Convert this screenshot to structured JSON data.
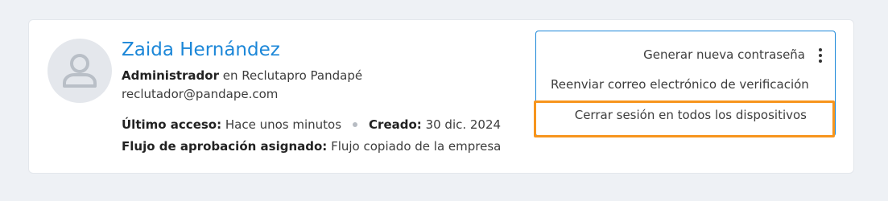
{
  "user": {
    "name": "Zaida Hernández",
    "role": "Administrador",
    "company_prefix": " en ",
    "company": "Reclutapro Pandapé",
    "email": "reclutador@pandape.com",
    "last_access_label": "Último acceso:",
    "last_access_value": " Hace unos minutos",
    "created_label": "Creado:",
    "created_value": " 30 dic. 2024",
    "flow_label": "Flujo de aprobación asignado:",
    "flow_value": " Flujo copiado de la empresa"
  },
  "menu": {
    "items": [
      "Generar nueva contraseña",
      "Reenviar correo electrónico de verificación",
      "Cerrar sesión en todos los dispositivos"
    ],
    "kebab_icon": "more-vertical-icon"
  },
  "colors": {
    "accent": "#1c87d8",
    "highlight": "#f7951d",
    "background": "#eef1f5"
  }
}
